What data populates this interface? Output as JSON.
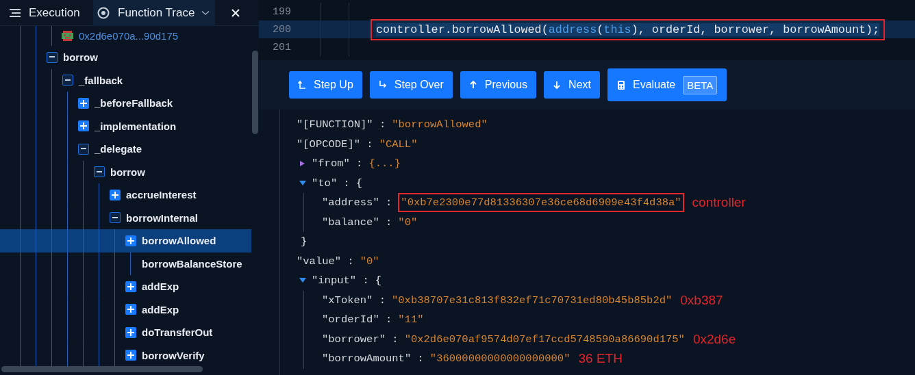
{
  "header": {
    "title": "Execution",
    "view_selector": {
      "label": "Function Trace"
    }
  },
  "tree": [
    {
      "kind": "address",
      "label": "0x2d6e070a...90d175",
      "selected": false
    },
    {
      "kind": "call",
      "label": "borrow",
      "expanded": true,
      "selected": false,
      "children": [
        {
          "kind": "call",
          "label": "_fallback",
          "expanded": true,
          "selected": false,
          "children": [
            {
              "kind": "call",
              "label": "_beforeFallback",
              "expanded": false,
              "selected": false
            },
            {
              "kind": "call",
              "label": "_implementation",
              "expanded": false,
              "selected": false
            },
            {
              "kind": "call",
              "label": "_delegate",
              "expanded": true,
              "selected": false,
              "children": [
                {
                  "kind": "call",
                  "label": "borrow",
                  "expanded": true,
                  "selected": false,
                  "children": [
                    {
                      "kind": "call",
                      "label": "accrueInterest",
                      "expanded": false,
                      "selected": false
                    },
                    {
                      "kind": "call",
                      "label": "borrowInternal",
                      "expanded": true,
                      "selected": false,
                      "children": [
                        {
                          "kind": "call",
                          "label": "borrowAllowed",
                          "expanded": false,
                          "selected": true
                        },
                        {
                          "kind": "leaf",
                          "label": "borrowBalanceStore",
                          "selected": false
                        },
                        {
                          "kind": "call",
                          "label": "addExp",
                          "expanded": false,
                          "selected": false
                        },
                        {
                          "kind": "call",
                          "label": "addExp",
                          "expanded": false,
                          "selected": false
                        },
                        {
                          "kind": "call",
                          "label": "doTransferOut",
                          "expanded": false,
                          "selected": false
                        },
                        {
                          "kind": "call",
                          "label": "borrowVerify",
                          "expanded": false,
                          "selected": false
                        }
                      ]
                    }
                  ]
                }
              ]
            }
          ]
        }
      ]
    }
  ],
  "code": {
    "lines": [
      {
        "number": "199",
        "highlighted": false
      },
      {
        "number": "200",
        "highlighted": true,
        "boxed": true,
        "tokens": [
          {
            "kind": "plain",
            "text": "controller.borrowAllowed("
          },
          {
            "kind": "keyword",
            "text": "address"
          },
          {
            "kind": "plain",
            "text": "("
          },
          {
            "kind": "keyword",
            "text": "this"
          },
          {
            "kind": "plain",
            "text": "), orderId, borrower, borrowAmount);"
          }
        ]
      },
      {
        "number": "201",
        "highlighted": false
      }
    ]
  },
  "toolbar": {
    "buttons": [
      {
        "kind": "step-up",
        "label": "Step Up"
      },
      {
        "kind": "step-over",
        "label": "Step Over"
      },
      {
        "kind": "previous",
        "label": "Previous"
      },
      {
        "kind": "next",
        "label": "Next"
      },
      {
        "kind": "evaluate",
        "label": "Evaluate",
        "badge": "BETA"
      }
    ]
  },
  "json_view": {
    "rows": [
      {
        "kind": "pair",
        "key": "\"[FUNCTION]\" :",
        "value": "\"borrowAllowed\""
      },
      {
        "kind": "pair",
        "key": "\"[OPCODE]\" :",
        "value": "\"CALL\""
      },
      {
        "kind": "object",
        "key": "\"from\" :",
        "expanded": false,
        "preview": "{...}"
      },
      {
        "kind": "object",
        "key": "\"to\" :",
        "expanded": true,
        "open": "{",
        "close": "}",
        "children": [
          {
            "kind": "pair",
            "key": "\"address\" :",
            "value": "\"0xb7e2300e77d81336307e36ce68d6909e43f4d38a\"",
            "boxed": true,
            "note": "controller"
          },
          {
            "kind": "pair",
            "key": "\"balance\" :",
            "value": "\"0\""
          }
        ]
      },
      {
        "kind": "pair",
        "key": "\"value\" :",
        "value": "\"0\""
      },
      {
        "kind": "object",
        "key": "\"input\" :",
        "expanded": true,
        "open": "{",
        "children": [
          {
            "kind": "pair",
            "key": "\"xToken\" :",
            "value": "\"0xb38707e31c813f832ef71c70731ed80b45b85b2d\"",
            "note": "0xb387"
          },
          {
            "kind": "pair",
            "key": "\"orderId\" :",
            "value": "\"11\""
          },
          {
            "kind": "pair",
            "key": "\"borrower\" :",
            "value": "\"0x2d6e070af9574d07ef17ccd5748590a86690d175\"",
            "note": "0x2d6e"
          },
          {
            "kind": "pair",
            "key": "\"borrowAmount\" :",
            "value": "\"36000000000000000000\"",
            "note": "36 ETH"
          }
        ]
      }
    ]
  }
}
